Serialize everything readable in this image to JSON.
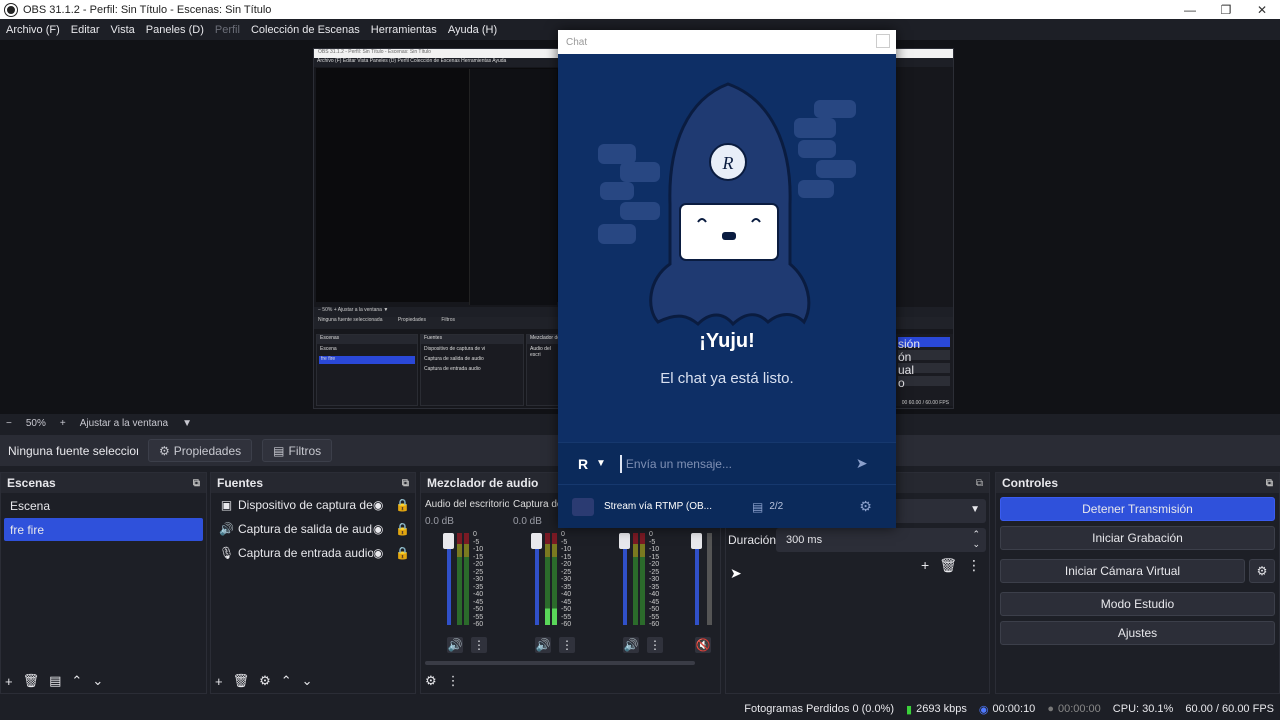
{
  "window": {
    "title": "OBS 31.1.2 - Perfil: Sin Título - Escenas: Sin Título",
    "minimize": "—",
    "maximize": "❐",
    "close": "✕"
  },
  "menu": [
    "Archivo (F)",
    "Editar",
    "Vista",
    "Paneles (D)",
    "Perfil",
    "Colección de Escenas",
    "Herramientas",
    "Ayuda (H)"
  ],
  "zoom": {
    "minus": "−",
    "level": "50%",
    "plus": "+",
    "fit": "Ajustar a la ventana",
    "caret": "▼"
  },
  "propbar": {
    "no_source": "Ninguna fuente seleccionada",
    "properties": "Propiedades",
    "filters": "Filtros"
  },
  "scenes": {
    "title": "Escenas",
    "items": [
      "Escena",
      "fre fire"
    ],
    "selected": 1
  },
  "sources": {
    "title": "Fuentes",
    "items": [
      {
        "label": "Dispositivo de captura de vi",
        "icon": "camera-icon"
      },
      {
        "label": "Captura de salida de audio",
        "icon": "speaker-icon"
      },
      {
        "label": "Captura de entrada audio",
        "icon": "microphone-icon"
      }
    ]
  },
  "mixer": {
    "title": "Mezclador de audio",
    "channels": [
      {
        "name": "Audio del escritorio",
        "db": "0.0 dB"
      },
      {
        "name": "Captura de",
        "db": "0.0 dB"
      },
      {
        "name": "",
        "db": ""
      },
      {
        "name": "",
        "db": ""
      }
    ],
    "scale": [
      "0",
      "-5",
      "-10",
      "-15",
      "-20",
      "-25",
      "-30",
      "-35",
      "-40",
      "-45",
      "-50",
      "-55",
      "-60"
    ]
  },
  "transitions": {
    "duration_label": "Duración",
    "duration_value": "300 ms"
  },
  "controls": {
    "title": "Controles",
    "stop_stream": "Detener Transmisión",
    "start_recording": "Iniciar Grabación",
    "virtual_cam": "Iniciar Cámara Virtual",
    "studio_mode": "Modo Estudio",
    "settings": "Ajustes"
  },
  "status": {
    "dropped": "Fotogramas Perdidos 0 (0.0%)",
    "bitrate": "2693 kbps",
    "stream_time": "00:00:10",
    "rec_time": "00:00:00",
    "cpu": "CPU: 30.1%",
    "fps": "60.00 / 60.00 FPS"
  },
  "chat": {
    "title": "Chat",
    "heading": "¡Yuju!",
    "message": "El chat ya está listo.",
    "input_placeholder": "Envía un mensaje...",
    "account_letter": "R",
    "mascot_letter": "R",
    "stream_label": "Stream vía RTMP (OB...",
    "count": "2/2"
  },
  "nested": {
    "title": "OBS 31.1.2 - Perfil: Sin Título - Escenas: Sin Título",
    "menu": "Archivo (F)  Editar  Vista  Paneles (D)  Perfil  Colección de Escenas  Herramientas  Ayuda",
    "zoom": "−  50%  +  Ajustar a la ventana  ▼",
    "no_source": "Ninguna fuente seleccionada",
    "props": "Propiedades",
    "filters": "Filtros",
    "scenes": "Escenas",
    "scene_1": "Escena",
    "scene_2": "fre fire",
    "sources": "Fuentes",
    "src_1": "Dispositivo de captura de vi",
    "src_2": "Captura de salida de audio",
    "src_3": "Captura de entrada audio",
    "mixer": "Mezclador de",
    "mixer_ch": "Audio del escri",
    "btn_1": "sión",
    "btn_2": "ón",
    "btn_3": "ual",
    "btn_4": "o",
    "fps": "00  60.00 / 60.00 FPS"
  }
}
